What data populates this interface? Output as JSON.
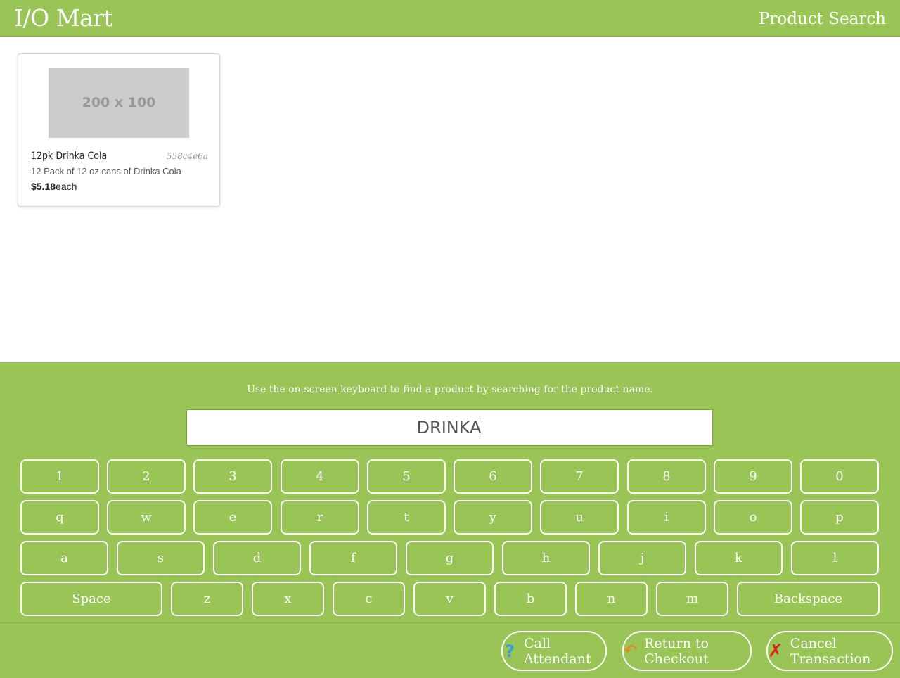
{
  "header": {
    "brand": "I/O Mart",
    "page_title": "Product Search"
  },
  "results": [
    {
      "image_placeholder": "200 x 100",
      "name": "12pk Drinka Cola",
      "id": "558c4e6a",
      "description": "12 Pack of 12 oz cans of Drinka Cola",
      "price": "$5.18",
      "unit": "each"
    }
  ],
  "keyboard": {
    "instructions": "Use the on-screen keyboard to find a product by searching for the product name.",
    "search_value": "DRINKA",
    "row1": [
      "1",
      "2",
      "3",
      "4",
      "5",
      "6",
      "7",
      "8",
      "9",
      "0"
    ],
    "row2": [
      "q",
      "w",
      "e",
      "r",
      "t",
      "y",
      "u",
      "i",
      "o",
      "p"
    ],
    "row3": [
      "a",
      "s",
      "d",
      "f",
      "g",
      "h",
      "j",
      "k",
      "l"
    ],
    "row4": [
      "Space",
      "z",
      "x",
      "c",
      "v",
      "b",
      "n",
      "m",
      "Backspace"
    ]
  },
  "footer": {
    "call_attendant": "Call Attendant",
    "return_checkout": "Return to Checkout",
    "cancel_transaction": "Cancel Transaction",
    "icons": {
      "call_attendant": "question-icon",
      "return_checkout": "back-arrow-icon",
      "cancel_transaction": "x-icon"
    },
    "colors": {
      "question": "#3aa0d8",
      "arrow": "#e8862a",
      "cancel": "#e02020"
    }
  },
  "colors": {
    "accent": "#99c456"
  }
}
